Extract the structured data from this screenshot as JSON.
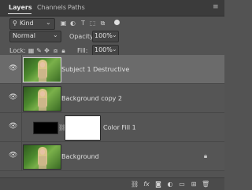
{
  "tabs": [
    {
      "label": "Layers",
      "active": true
    },
    {
      "label": "Channels",
      "active": false
    },
    {
      "label": "Paths",
      "active": false
    }
  ],
  "panel_menu_icon": "hamburger-icon",
  "filter": {
    "kind_label": "Kind",
    "icons": [
      "image-filter-icon",
      "adjustment-filter-icon",
      "type-filter-icon",
      "shape-filter-icon",
      "smart-object-filter-icon"
    ]
  },
  "blend": {
    "mode": "Normal",
    "opacity_label": "Opacity:",
    "opacity_value": "100%"
  },
  "lock": {
    "label": "Lock:",
    "fill_label": "Fill:",
    "fill_value": "100%",
    "icons": [
      "lock-transparent-icon",
      "lock-pixels-icon",
      "lock-position-icon",
      "lock-artboard-icon",
      "lock-all-icon"
    ]
  },
  "layers": [
    {
      "name": "Subject 1 Destructive",
      "visible": true,
      "selected": true,
      "type": "photo",
      "locked": false
    },
    {
      "name": "Background copy 2",
      "visible": true,
      "selected": false,
      "type": "photo",
      "locked": false
    },
    {
      "name": "Color Fill 1",
      "visible": true,
      "selected": false,
      "type": "fill",
      "locked": false
    },
    {
      "name": "Background",
      "visible": true,
      "selected": false,
      "type": "photo",
      "locked": true
    }
  ],
  "bottom_icons": [
    "link-layers-icon",
    "fx-icon",
    "add-mask-icon",
    "adjustment-layer-icon",
    "new-group-icon",
    "new-layer-icon",
    "trash-icon"
  ],
  "colors": {
    "panel_bg": "#535353",
    "selected_row": "#6b6b6b"
  }
}
